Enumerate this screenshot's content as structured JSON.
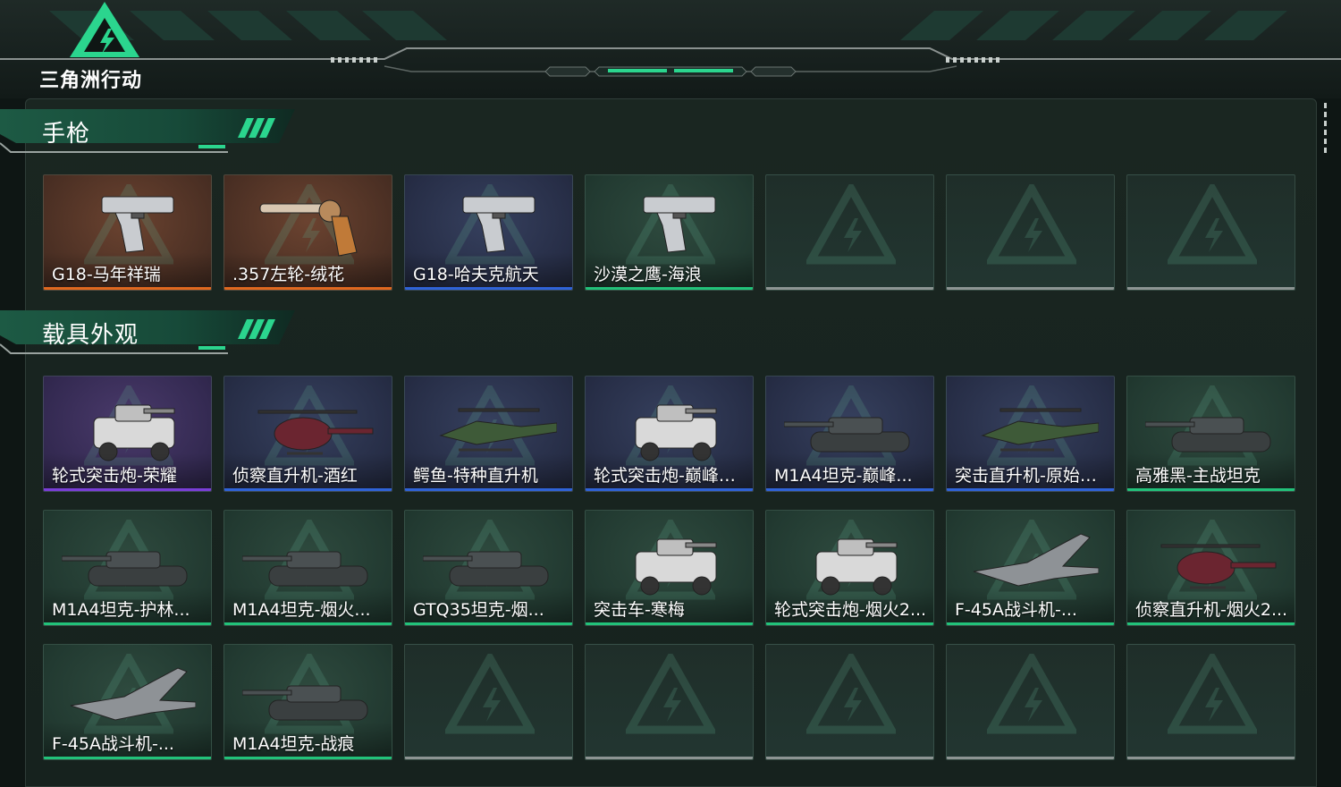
{
  "app": {
    "logo_text": "三角洲行动",
    "accent_color": "#2bd58e"
  },
  "rarity_colors": {
    "orange": "#e0681f",
    "blue": "#2f63d8",
    "purple": "#7a3ed8",
    "green": "#22c27a",
    "empty": "#8d9593"
  },
  "sections": [
    {
      "title": "手枪",
      "rows": [
        [
          {
            "label": "G18-马年祥瑞",
            "rarity": "orange",
            "icon": "pistol-icon"
          },
          {
            "label": ".357左轮-绒花",
            "rarity": "orange",
            "icon": "revolver-icon"
          },
          {
            "label": "G18-哈夫克航天",
            "rarity": "blue",
            "icon": "pistol-icon"
          },
          {
            "label": "沙漠之鹰-海浪",
            "rarity": "green",
            "icon": "pistol-icon"
          },
          {
            "label": "",
            "rarity": "empty",
            "icon": "empty-slot-icon"
          },
          {
            "label": "",
            "rarity": "empty",
            "icon": "empty-slot-icon"
          },
          {
            "label": "",
            "rarity": "empty",
            "icon": "empty-slot-icon"
          }
        ]
      ]
    },
    {
      "title": "载具外观",
      "rows": [
        [
          {
            "label": "轮式突击炮-荣耀",
            "rarity": "purple",
            "icon": "armored-car-icon"
          },
          {
            "label": "侦察直升机-酒红",
            "rarity": "blue",
            "icon": "helicopter-icon"
          },
          {
            "label": "鳄鱼-特种直升机",
            "rarity": "blue",
            "icon": "attack-helicopter-icon"
          },
          {
            "label": "轮式突击炮-巅峰竞...",
            "rarity": "blue",
            "icon": "armored-car-icon"
          },
          {
            "label": "M1A4坦克-巅峰...",
            "rarity": "blue",
            "icon": "tank-icon"
          },
          {
            "label": "突击直升机-原始伪...",
            "rarity": "blue",
            "icon": "attack-helicopter-icon"
          },
          {
            "label": "高雅黑-主战坦克",
            "rarity": "green",
            "icon": "tank-icon"
          }
        ],
        [
          {
            "label": "M1A4坦克-护林...",
            "rarity": "green",
            "icon": "tank-icon"
          },
          {
            "label": "M1A4坦克-烟火...",
            "rarity": "green",
            "icon": "tank-icon"
          },
          {
            "label": "GTQ35坦克-烟...",
            "rarity": "green",
            "icon": "tank-icon"
          },
          {
            "label": "突击车-寒梅",
            "rarity": "green",
            "icon": "armored-car-icon"
          },
          {
            "label": "轮式突击炮-烟火2...",
            "rarity": "green",
            "icon": "armored-car-icon"
          },
          {
            "label": "F-45A战斗机-...",
            "rarity": "green",
            "icon": "fighter-jet-icon"
          },
          {
            "label": "侦察直升机-烟火2...",
            "rarity": "green",
            "icon": "helicopter-icon"
          }
        ],
        [
          {
            "label": "F-45A战斗机-...",
            "rarity": "green",
            "icon": "fighter-jet-icon"
          },
          {
            "label": "M1A4坦克-战痕",
            "rarity": "green",
            "icon": "tank-icon"
          },
          {
            "label": "",
            "rarity": "empty",
            "icon": "empty-slot-icon"
          },
          {
            "label": "",
            "rarity": "empty",
            "icon": "empty-slot-icon"
          },
          {
            "label": "",
            "rarity": "empty",
            "icon": "empty-slot-icon"
          },
          {
            "label": "",
            "rarity": "empty",
            "icon": "empty-slot-icon"
          },
          {
            "label": "",
            "rarity": "empty",
            "icon": "empty-slot-icon"
          }
        ]
      ]
    }
  ]
}
